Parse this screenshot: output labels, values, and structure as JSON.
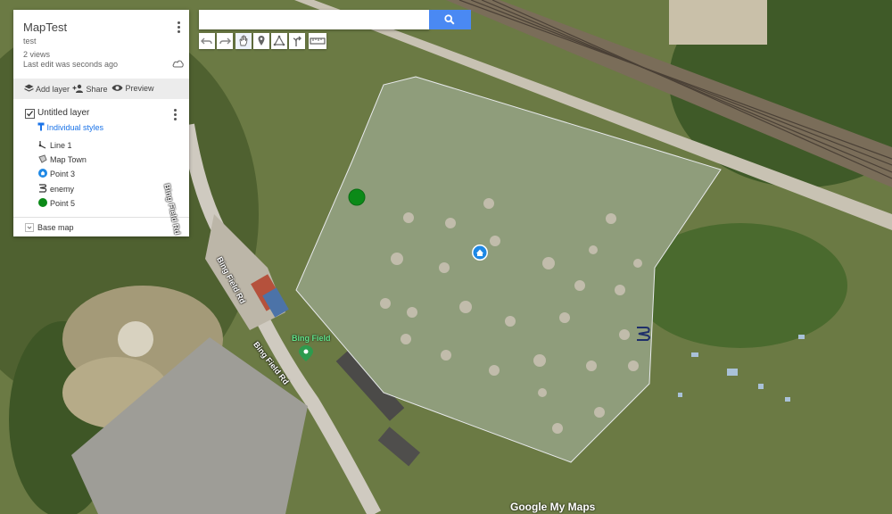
{
  "map": {
    "title": "MapTest",
    "description": "test",
    "views": "2 views",
    "last_edit": "Last edit was seconds ago",
    "actions": {
      "add_layer": "Add layer",
      "share": "Share",
      "preview": "Preview"
    },
    "layer": {
      "name": "Untitled layer",
      "checked": true,
      "styles_link": "Individual styles",
      "items": [
        {
          "label": "Line 1",
          "icon": "line-icon"
        },
        {
          "label": "Map Town",
          "icon": "polygon-icon"
        },
        {
          "label": "Point 3",
          "icon": "home-marker-icon",
          "color": "#1e88e5"
        },
        {
          "label": "enemy",
          "icon": "enemy-line-icon"
        },
        {
          "label": "Point 5",
          "icon": "circle-marker-icon",
          "color": "#0b8a18"
        }
      ]
    },
    "base_map": "Base map"
  },
  "search": {
    "placeholder": "",
    "button_icon": "search-icon"
  },
  "toolbar": [
    "undo-icon",
    "redo-icon",
    "hand-icon",
    "add-marker-icon",
    "draw-line-icon",
    "directions-icon",
    "measure-icon"
  ],
  "labels": {
    "road1": "Bing Field Rd",
    "road2": "Bing Field Rd",
    "road3": "Bing Field Rd",
    "poi": "Bing Field"
  },
  "attribution": "Google My Maps",
  "colors": {
    "accent": "#4a89f3",
    "link": "#1a73e8",
    "polygon_fill": "rgba(190,200,215,0.28)"
  }
}
